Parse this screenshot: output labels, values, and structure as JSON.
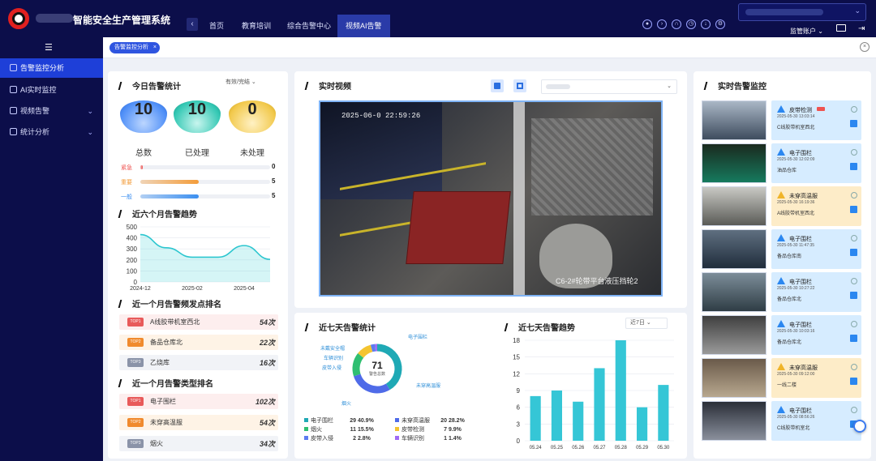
{
  "app": {
    "title": "智能安全生产管理系统",
    "account_label": "监管账户",
    "back_icon": "‹"
  },
  "nav": [
    {
      "label": "首页"
    },
    {
      "label": "教育培训"
    },
    {
      "label": "综合告警中心"
    },
    {
      "label": "视频AI告警"
    }
  ],
  "sidebar": {
    "items": [
      {
        "label": "告警监控分析",
        "active": true
      },
      {
        "label": "AI实时监控"
      },
      {
        "label": "视频告警"
      },
      {
        "label": "统计分析"
      }
    ]
  },
  "tabs": {
    "active_label": "告警监控分析",
    "close": "×"
  },
  "today": {
    "title": "今日告警统计",
    "filter": "有效/完结",
    "stats": [
      {
        "value": "10",
        "label": "总数",
        "color": "#4f8ff7"
      },
      {
        "value": "10",
        "label": "已处理",
        "color": "#34c8b4"
      },
      {
        "value": "0",
        "label": "未处理",
        "color": "#f2c94c"
      }
    ],
    "levels": [
      {
        "label": "紧急",
        "value": "0",
        "fraction": 0.02,
        "color": "#ef5350"
      },
      {
        "label": "重要",
        "value": "5",
        "fraction": 0.45,
        "color": "#f39c3a"
      },
      {
        "label": "一般",
        "value": "5",
        "fraction": 0.45,
        "color": "#3b8ff0"
      }
    ]
  },
  "trend6m": {
    "title": "近六个月告警趋势"
  },
  "rank_location": {
    "title": "近一个月告警频发点排名",
    "rows": [
      {
        "badge": "TOP1",
        "name": "A线胶带机室西北",
        "count": "54次",
        "color": "#e85a5a",
        "bg": "#fdeeee"
      },
      {
        "badge": "TOP2",
        "name": "备品仓库北",
        "count": "22次",
        "color": "#f08a2d",
        "bg": "#fef3e6"
      },
      {
        "badge": "TOP3",
        "name": "乙烧库",
        "count": "16次",
        "color": "#8a93a8",
        "bg": "#f1f3f7"
      }
    ]
  },
  "rank_type": {
    "title": "近一个月告警类型排名",
    "rows": [
      {
        "badge": "TOP1",
        "name": "电子围栏",
        "count": "102次",
        "color": "#e85a5a",
        "bg": "#fdeeee"
      },
      {
        "badge": "TOP2",
        "name": "未穿高温服",
        "count": "54次",
        "color": "#f08a2d",
        "bg": "#fef3e6"
      },
      {
        "badge": "TOP3",
        "name": "烟火",
        "count": "34次",
        "color": "#8a93a8",
        "bg": "#f1f3f7"
      }
    ]
  },
  "video": {
    "title": "实时视频",
    "timestamp": "2025-06-0  22:59:26",
    "caption": "C6-2#轮带平台液压挡轮2"
  },
  "week_stats": {
    "title": "近七天告警统计",
    "total": "71",
    "total_label": "警告总数",
    "rows": [
      {
        "name": "电子围栏",
        "count": "29",
        "pct": "40.9%",
        "color": "#1fa9b5"
      },
      {
        "name": "未穿高温服",
        "count": "20",
        "pct": "28.2%",
        "color": "#4f6be8"
      },
      {
        "name": "烟火",
        "count": "11",
        "pct": "15.5%",
        "color": "#2fbf71"
      },
      {
        "name": "皮带检测",
        "count": "7",
        "pct": "9.9%",
        "color": "#f4c430"
      },
      {
        "name": "皮带入侵",
        "count": "2",
        "pct": "2.8%",
        "color": "#5d7bf0"
      },
      {
        "name": "车辆识别",
        "count": "1",
        "pct": "1.4%",
        "color": "#a06bf5"
      }
    ],
    "donut_labels": [
      "电子围栏",
      "未穿高温服",
      "烟火",
      "皮带入侵",
      "车辆识别",
      "未戴安全帽"
    ]
  },
  "week_trend": {
    "title": "近七天告警趋势",
    "filter": "近7日"
  },
  "realtime": {
    "title": "实时告警监控",
    "items": [
      {
        "type": "皮带检测",
        "time": "2025-05-30 13:03:14",
        "loc": "C线胶带机室西北",
        "color": "#d6ecff"
      },
      {
        "type": "电子围栏",
        "time": "2025-05-30 12:02:09",
        "loc": "油品仓库",
        "color": "#d6ecff"
      },
      {
        "type": "未穿高温服",
        "time": "2025-05-30 16:19:36",
        "loc": "A线胶带机室西北",
        "color": "#fdecc8"
      },
      {
        "type": "电子围栏",
        "time": "2025-05-30 11:47:35",
        "loc": "备品仓库南",
        "color": "#d6ecff"
      },
      {
        "type": "电子围栏",
        "time": "2025-05-30 10:27:22",
        "loc": "备品仓库北",
        "color": "#d6ecff"
      },
      {
        "type": "电子围栏",
        "time": "2025-05-30 10:03:16",
        "loc": "备品仓库北",
        "color": "#d6ecff"
      },
      {
        "type": "未穿高温服",
        "time": "2025-05-30 09:12:00",
        "loc": "一线二楼",
        "color": "#fdecc8"
      },
      {
        "type": "电子围栏",
        "time": "2025-05-30 08:56:26",
        "loc": "C线胶带机室北",
        "color": "#d6ecff"
      }
    ]
  },
  "colors": {
    "accent": "#1e3fd8",
    "topbar": "#0c0e4a"
  },
  "chart_data": [
    {
      "type": "area",
      "x": [
        "2024-12",
        "2025-01",
        "2025-02",
        "2025-03",
        "2025-04",
        "2025-05"
      ],
      "values": [
        430,
        310,
        225,
        225,
        330,
        205
      ],
      "xticks": [
        "2024-12",
        "2025-02",
        "2025-04"
      ],
      "yticks": [
        "0",
        "100",
        "200",
        "300",
        "400",
        "500"
      ],
      "ylim": [
        0,
        500
      ]
    },
    {
      "type": "bar",
      "categories": [
        "05.24",
        "05.25",
        "05.26",
        "05.27",
        "05.28",
        "05.29",
        "05.30"
      ],
      "values": [
        8,
        9,
        7,
        13,
        18,
        6,
        10
      ],
      "yticks": [
        "0",
        "3",
        "6",
        "9",
        "12",
        "15",
        "18"
      ],
      "ylim": [
        0,
        18
      ]
    },
    {
      "type": "pie",
      "categories": [
        "电子围栏",
        "未穿高温服",
        "烟火",
        "皮带检测",
        "皮带入侵",
        "车辆识别"
      ],
      "values": [
        29,
        20,
        11,
        7,
        2,
        1
      ]
    }
  ]
}
